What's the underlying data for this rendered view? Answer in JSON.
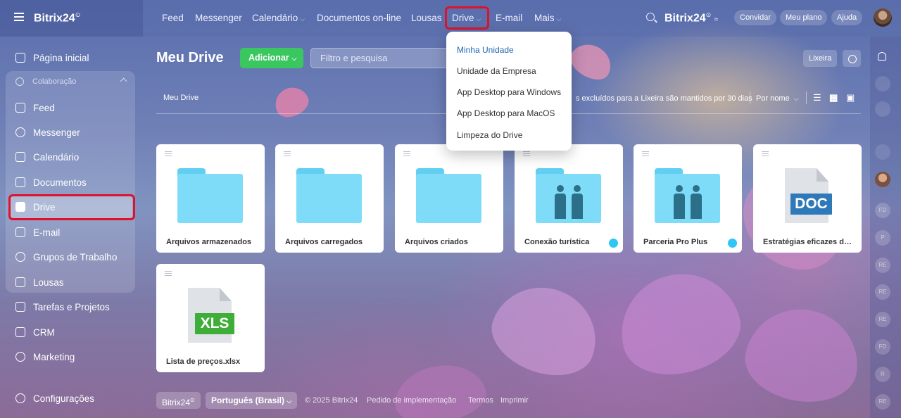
{
  "top": {
    "logo": "Bitrix24",
    "logo_mark": "⊙",
    "nav": [
      {
        "label": "Feed",
        "dropdown": false
      },
      {
        "label": "Messenger",
        "dropdown": false
      },
      {
        "label": "Calendário",
        "dropdown": true
      },
      {
        "label": "Documentos on-line",
        "dropdown": false
      },
      {
        "label": "Lousas",
        "dropdown": false
      },
      {
        "label": "Drive",
        "dropdown": true
      },
      {
        "label": "E-mail",
        "dropdown": false
      },
      {
        "label": "Mais",
        "dropdown": true
      }
    ],
    "brand": "Bitrix24",
    "invite": "Convidar",
    "my_plan": "Meu plano",
    "help": "Ajuda"
  },
  "sidebar": {
    "home": "Página inicial",
    "collab_header": "Colaboração",
    "items": [
      "Feed",
      "Messenger",
      "Calendário",
      "Documentos",
      "Drive",
      "E-mail",
      "Grupos de Trabalho",
      "Lousas"
    ],
    "more": [
      "Tarefas e Projetos",
      "CRM",
      "Marketing"
    ],
    "settings": "Configurações"
  },
  "main": {
    "title": "Meu Drive",
    "add": "Adicionar",
    "filter_placeholder": "Filtro e pesquisa",
    "trash": "Lixeira",
    "breadcrumb": "Meu Drive",
    "info": "s excluídos para a Lixeira são mantidos por 30 dias",
    "sort": "Por nome"
  },
  "files": [
    {
      "name": "Arquivos armazenados",
      "kind": "folder"
    },
    {
      "name": "Arquivos carregados",
      "kind": "folder"
    },
    {
      "name": "Arquivos criados",
      "kind": "folder"
    },
    {
      "name": "Conexão turística",
      "kind": "shared-folder"
    },
    {
      "name": "Parceria Pro Plus",
      "kind": "shared-folder"
    },
    {
      "name": "Estratégias eficazes de ma...",
      "kind": "doc",
      "label": "DOC"
    },
    {
      "name": "Lista de preços.xlsx",
      "kind": "xls",
      "label": "XLS"
    }
  ],
  "dropdown": {
    "items": [
      "Minha Unidade",
      "Unidade da Empresa",
      "App Desktop para Windows",
      "App Desktop para MacOS",
      "Limpeza do Drive"
    ],
    "active_index": 0
  },
  "rail": {
    "avatars": [
      "FD",
      "P",
      "RE",
      "RE",
      "RE",
      "FD",
      "R",
      "RE"
    ]
  },
  "footer": {
    "brand": "Bitrix24",
    "language": "Português (Brasil)",
    "copyright": "© 2025 Bitrix24",
    "links": [
      "Pedido de implementação",
      "Termos",
      "Imprimir"
    ]
  },
  "colors": {
    "accent_green": "#3bc760",
    "highlight_red": "#e0112b",
    "folder_blue": "#7fdcf8",
    "doc_blue": "#2f79b8",
    "xls_green": "#3fae38"
  }
}
